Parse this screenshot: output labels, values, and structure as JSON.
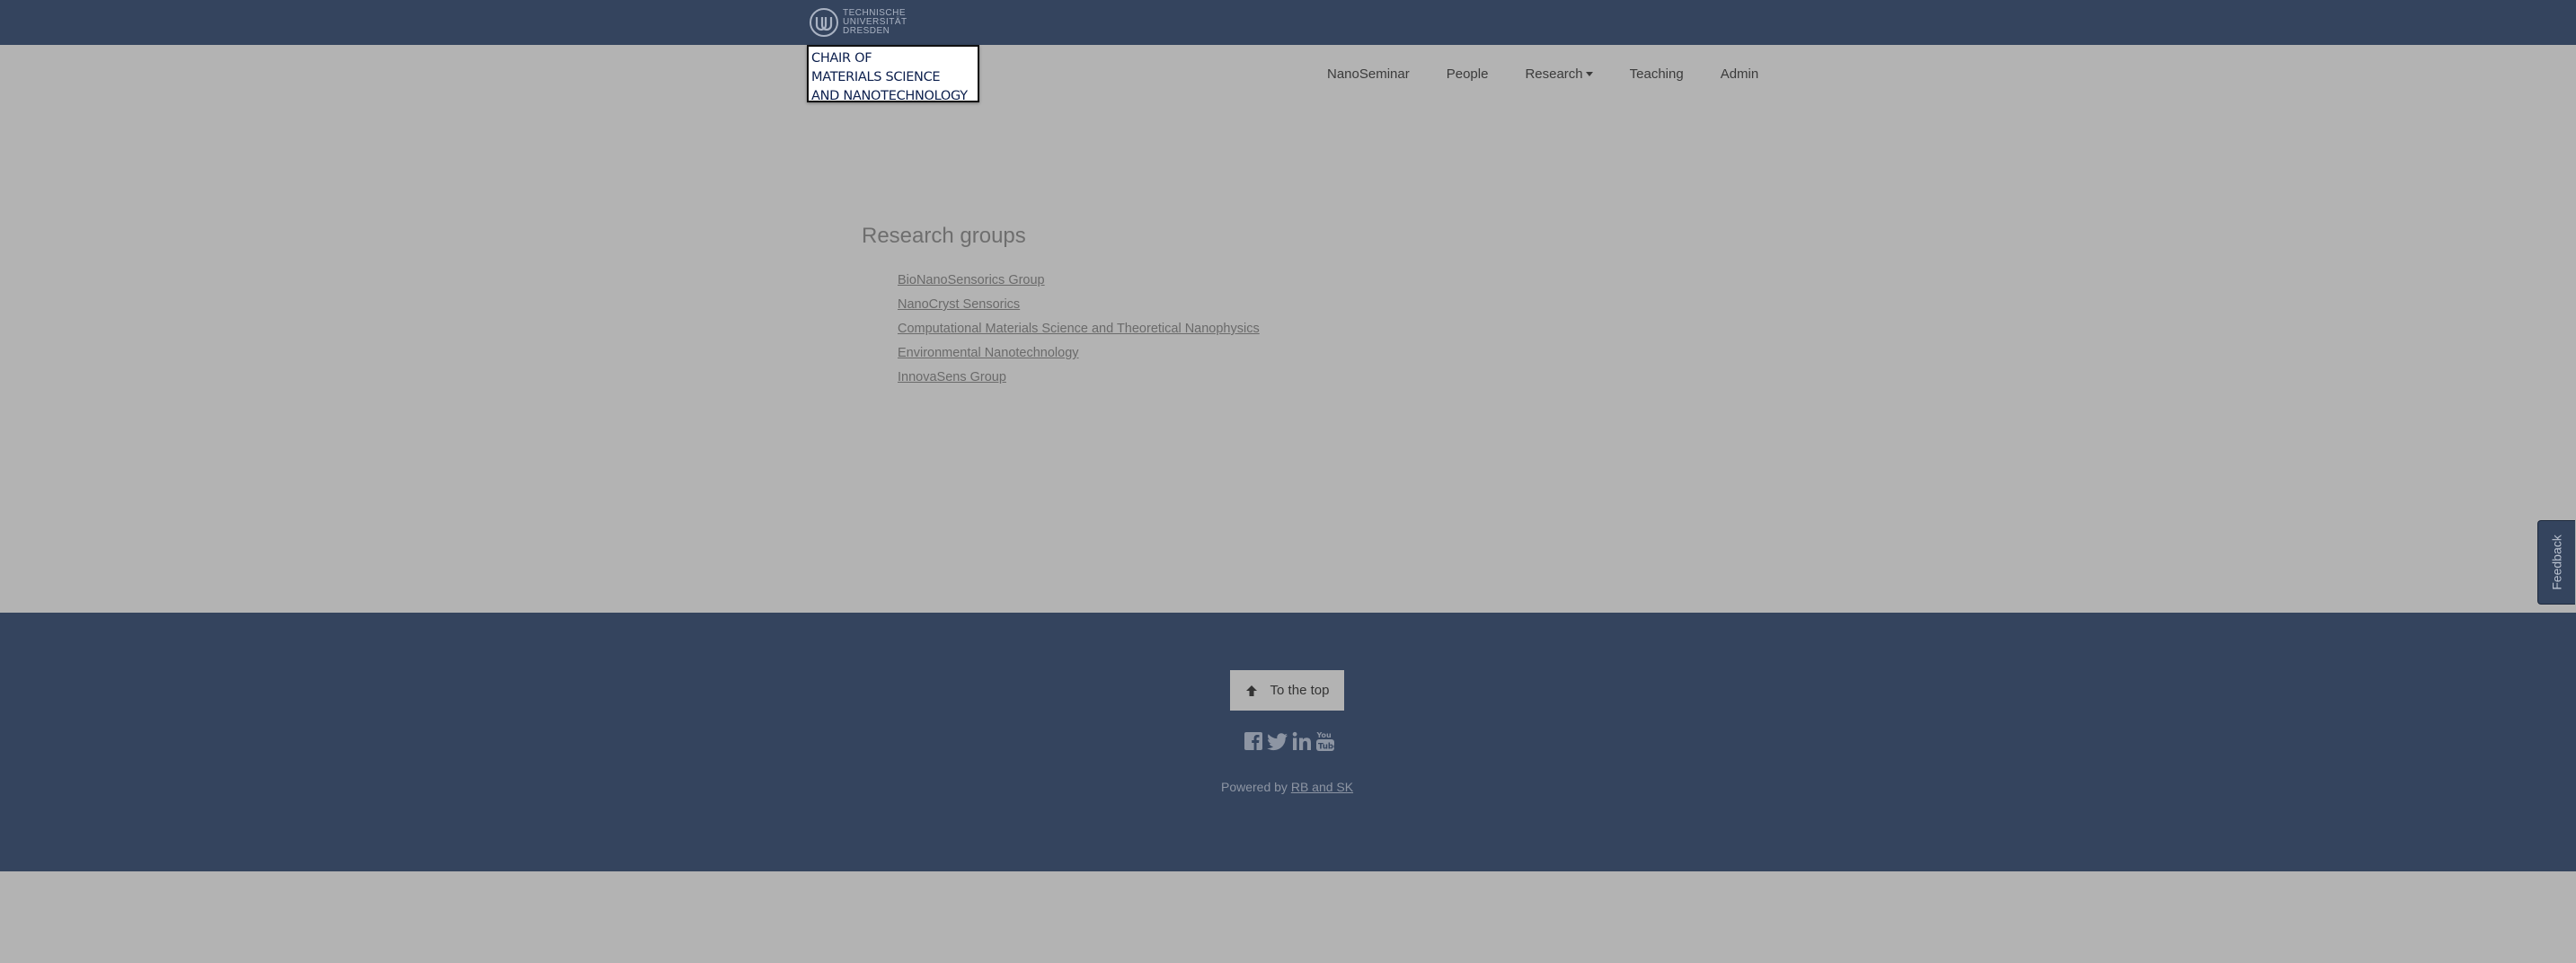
{
  "header": {
    "university_logo_lines": [
      "TECHNISCHE",
      "UNIVERSITÄT",
      "DRESDEN"
    ],
    "chair_lines": [
      "CHAIR OF",
      "MATERIALS SCIENCE",
      "AND NANOTECHNOLOGY"
    ],
    "nav": [
      {
        "label": "NanoSeminar"
      },
      {
        "label": "People"
      },
      {
        "label": "Research",
        "has_dropdown": true
      },
      {
        "label": "Teaching"
      },
      {
        "label": "Admin"
      }
    ]
  },
  "main": {
    "title": "Research groups",
    "groups": [
      "BioNanoSensorics Group",
      "NanoCryst Sensorics",
      "Computational Materials Science and Theoretical Nanophysics",
      "Environmental Nanotechnology",
      "InnovaSens Group"
    ]
  },
  "feedback": {
    "label": "Feedback"
  },
  "footer": {
    "to_top_label": "To the top",
    "social_icons": [
      "facebook-icon",
      "twitter-icon",
      "linkedin-icon",
      "youtube-icon"
    ],
    "powered_prefix": "Powered by",
    "powered_link": "RB and SK"
  },
  "colors": {
    "header_bg": "#34445e",
    "page_bg": "#b3b3b3",
    "chair_text": "#0c1f4d"
  }
}
